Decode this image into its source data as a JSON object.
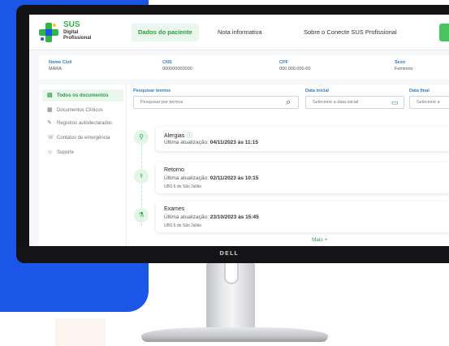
{
  "colors": {
    "brand_blue": "#1a56e8",
    "brand_green": "#2fb64b",
    "label_blue": "#2a7dc8"
  },
  "monitor": {
    "brand": "DELL"
  },
  "app": {
    "logo_name": "SUS",
    "logo_line1": "Digital",
    "logo_line2": "Profissional"
  },
  "nav": {
    "tabs": [
      {
        "label": "Dados do paciente",
        "active": true
      },
      {
        "label": "Nota informativa",
        "active": false
      },
      {
        "label": "Sobre o Conecte SUS Profissional",
        "active": false
      }
    ]
  },
  "patient": {
    "fields": [
      {
        "label": "Nome Civil",
        "value": "MARA"
      },
      {
        "label": "CNS",
        "value": "000000000000"
      },
      {
        "label": "CPF",
        "value": "000.000.000-00"
      },
      {
        "label": "Sexo",
        "value": "Feminino"
      }
    ]
  },
  "sidebar": {
    "items": [
      {
        "label": "Todos os documentos",
        "icon": "documents-icon",
        "active": true
      },
      {
        "label": "Documentos Clínicos",
        "icon": "clinical-doc-icon",
        "active": false
      },
      {
        "label": "Registros autodeclarados",
        "icon": "self-declared-icon",
        "active": false
      },
      {
        "label": "Contatos de emergência",
        "icon": "phone-icon",
        "active": false
      },
      {
        "label": "Suporte",
        "icon": "support-icon",
        "active": false
      }
    ]
  },
  "filters": {
    "search_label": "Pesquisar termos",
    "search_placeholder": "Pesquisar por termos",
    "start_label": "Data inicial",
    "start_placeholder": "Selecione a data inicial",
    "end_label": "Data final",
    "end_placeholder": "Selecione a"
  },
  "timeline": [
    {
      "title": "Alergias",
      "update_prefix": "Última atualização:",
      "update_value": "04/11/2023 às 11:15",
      "place": "",
      "icon": "allergy-icon"
    },
    {
      "title": "Retorno",
      "update_prefix": "Última atualização:",
      "update_value": "02/11/2023 às 10:15",
      "place": "UBS 6 de São Julião",
      "icon": "return-icon"
    },
    {
      "title": "Exames",
      "update_prefix": "Última atualização:",
      "update_value": "23/10/2023 às 15:45",
      "place": "UBS 6 de São Julião",
      "icon": "exam-icon"
    }
  ],
  "more_label": "Mais +"
}
